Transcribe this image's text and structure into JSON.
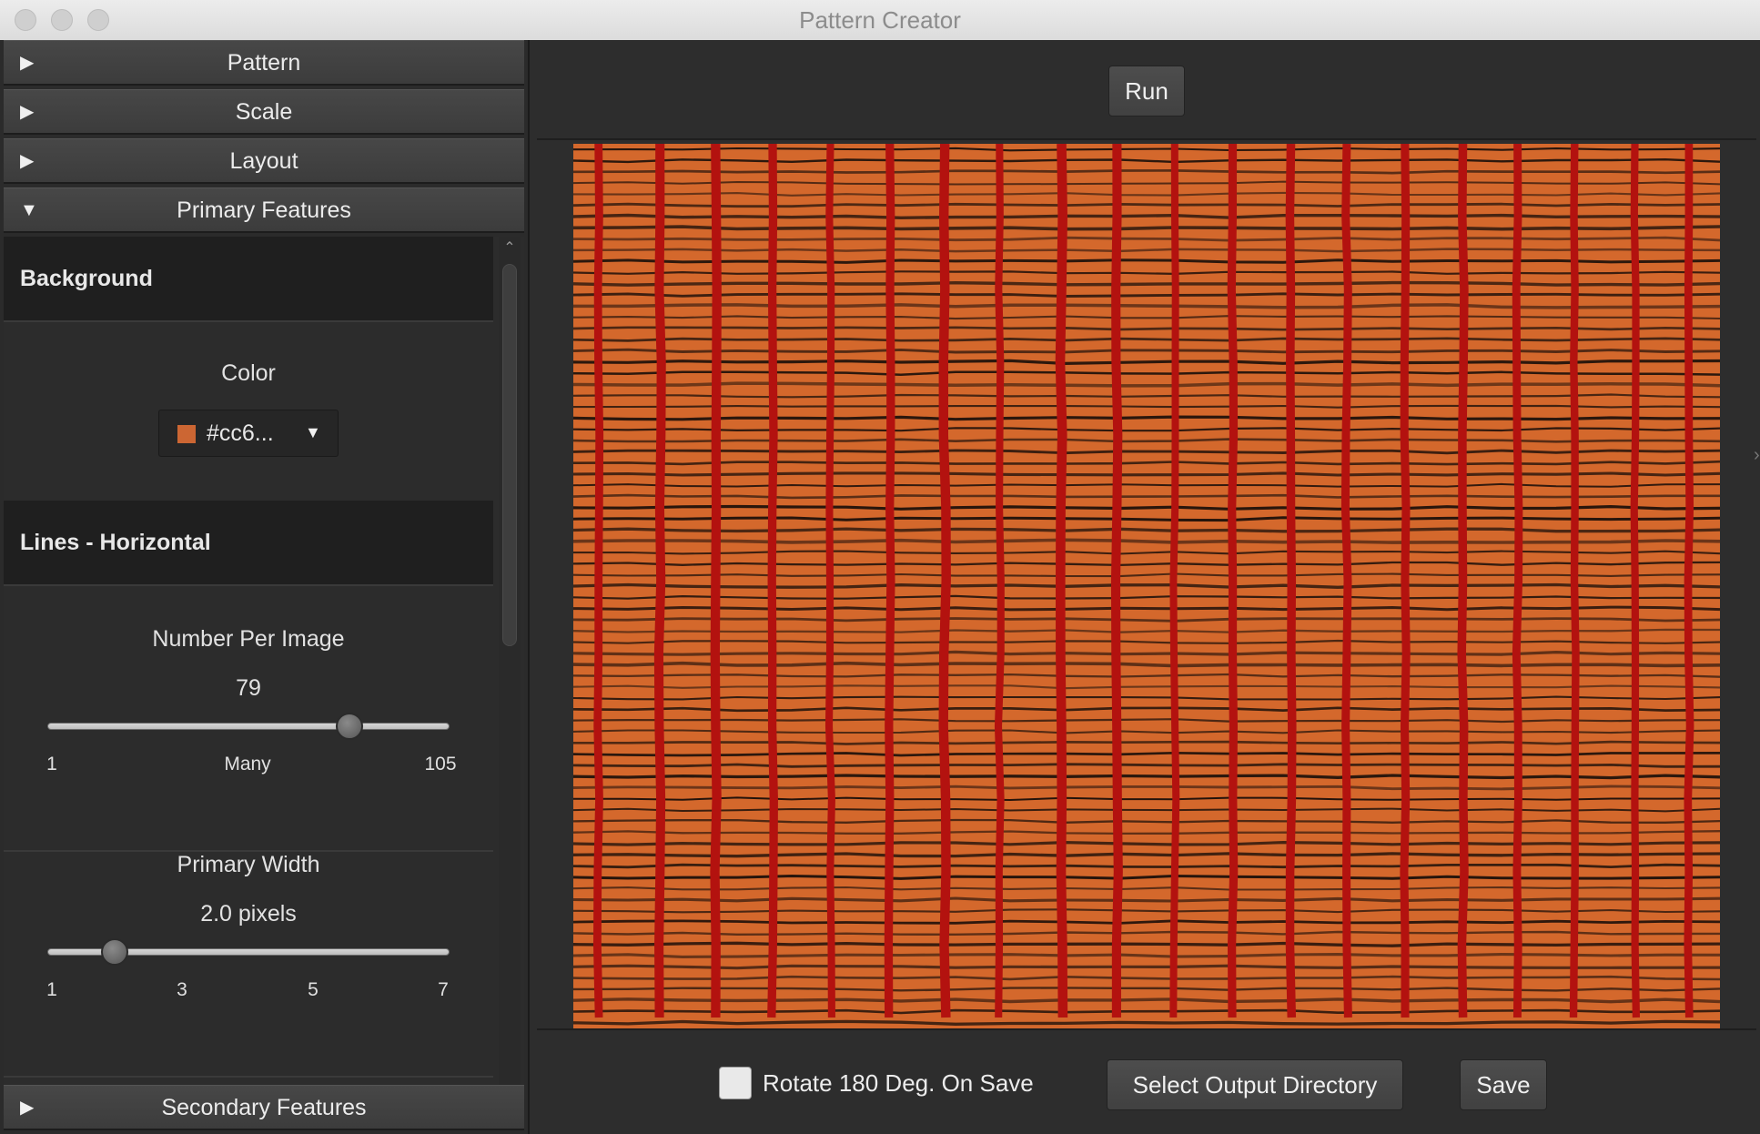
{
  "window": {
    "title": "Pattern Creator"
  },
  "sidebar": {
    "panels": [
      {
        "label": "Pattern",
        "expanded": false
      },
      {
        "label": "Scale",
        "expanded": false
      },
      {
        "label": "Layout",
        "expanded": false
      },
      {
        "label": "Primary Features",
        "expanded": true
      },
      {
        "label": "Secondary Features",
        "expanded": false
      }
    ],
    "primary_features": {
      "background": {
        "heading": "Background",
        "color_label": "Color",
        "color_value": "#cc6...",
        "swatch_color": "#cc6633"
      },
      "lines_horizontal": {
        "heading": "Lines - Horizontal",
        "number_per_image": {
          "label": "Number Per Image",
          "value": "79",
          "min": 1,
          "max": 105,
          "current": 79,
          "ticks": [
            "1",
            "Many",
            "105"
          ]
        },
        "primary_width": {
          "label": "Primary Width",
          "value": "2.0 pixels",
          "min": 1,
          "max": 7,
          "current": 2,
          "ticks": [
            "1",
            "3",
            "5",
            "7"
          ]
        }
      }
    }
  },
  "main": {
    "run_label": "Run",
    "pattern_preview": {
      "background": "#d4682c",
      "vertical_line_color": "#b3120f",
      "horizontal_line_color": "#1a0f0a"
    },
    "footer": {
      "rotate_label": "Rotate 180 Deg. On Save",
      "rotate_checked": false,
      "select_output_label": "Select Output Directory",
      "save_label": "Save"
    }
  }
}
